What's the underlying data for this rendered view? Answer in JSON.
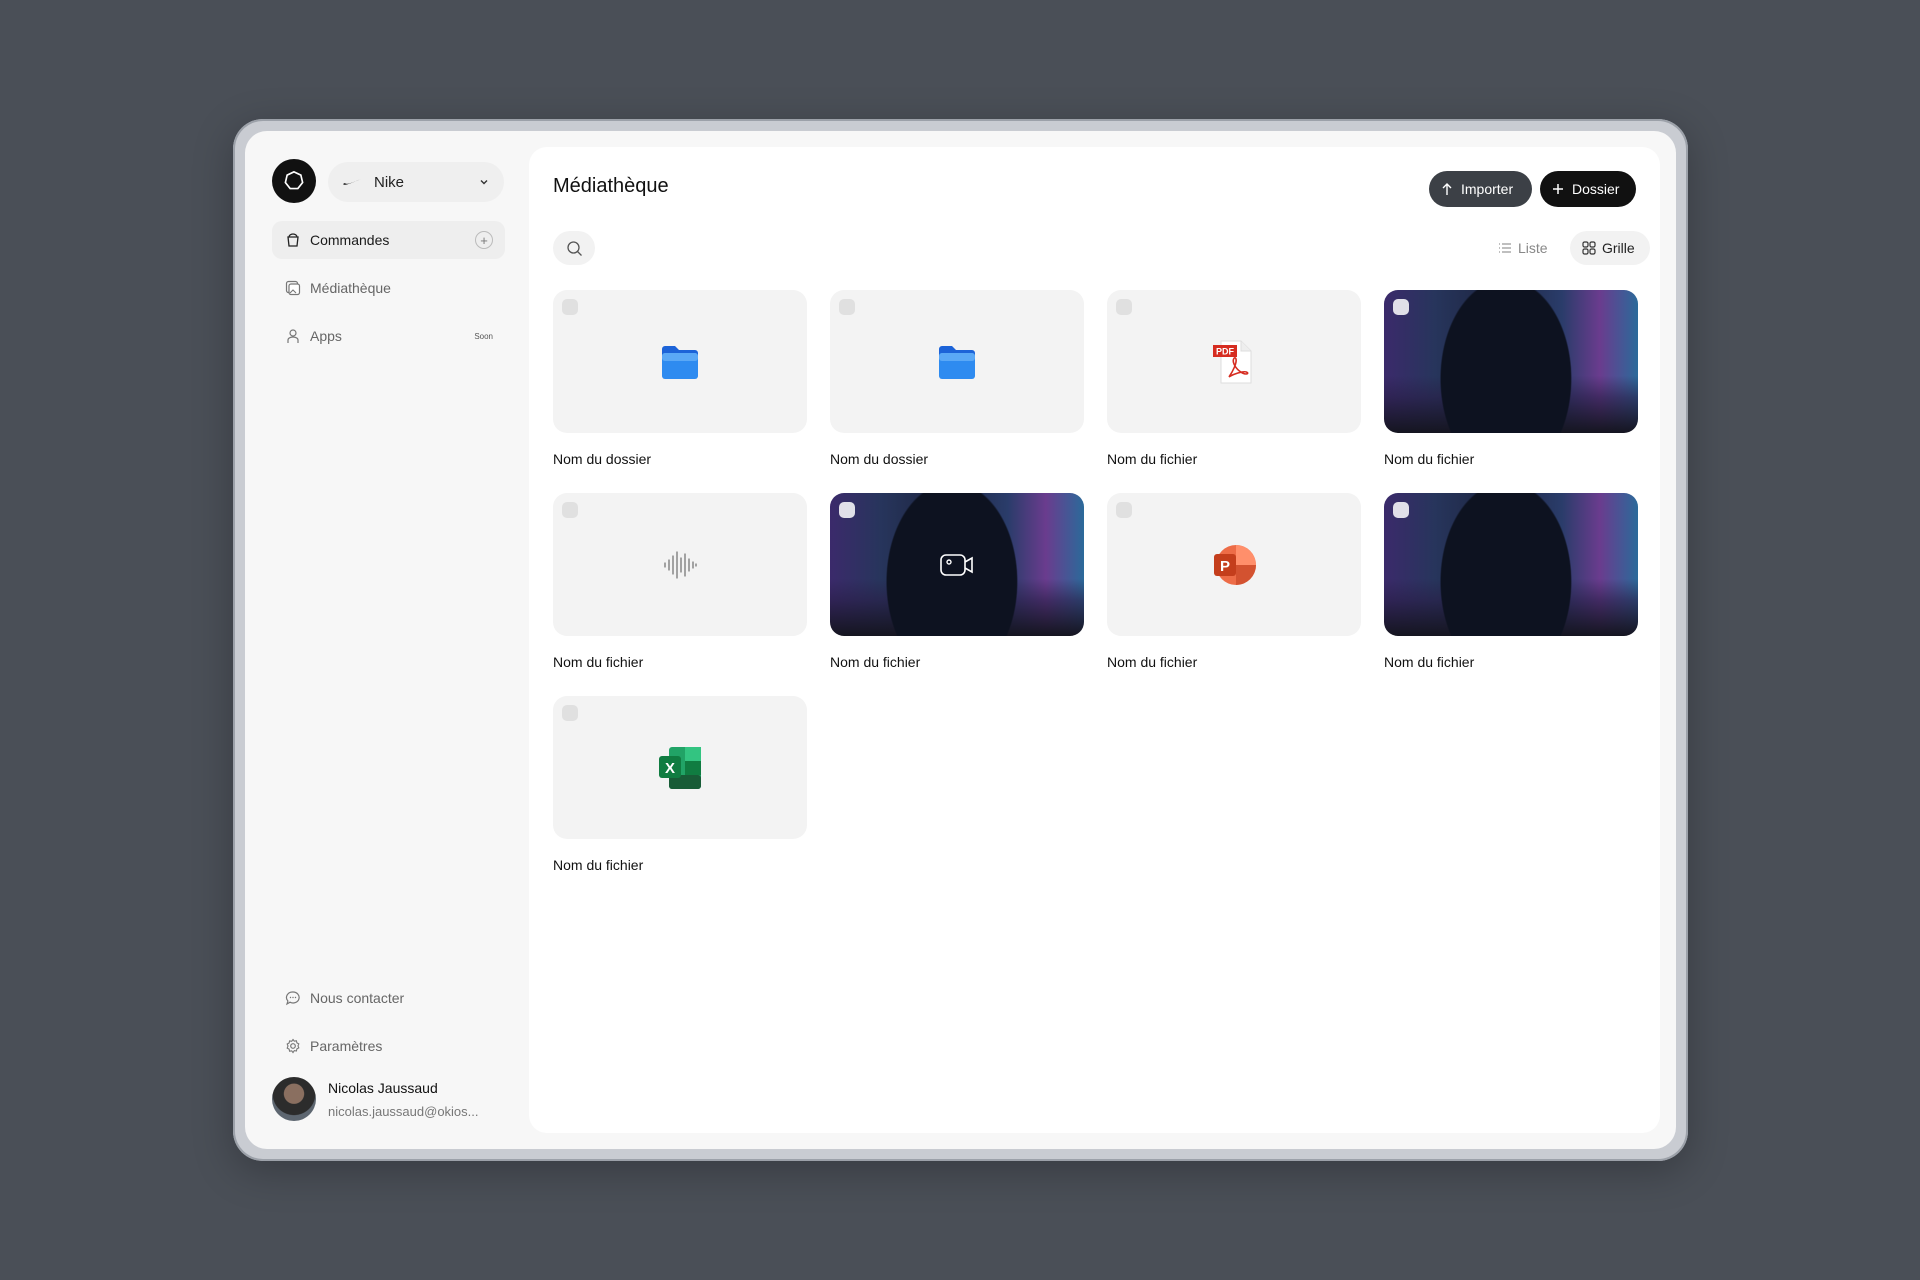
{
  "workspace": {
    "name": "Nike"
  },
  "nav": {
    "items": [
      {
        "label": "Commandes",
        "icon": "bucket-icon"
      },
      {
        "label": "Médiathèque",
        "icon": "media-icon"
      },
      {
        "label": "Apps",
        "icon": "person-icon",
        "badge": "Soon"
      }
    ],
    "contact": "Nous contacter",
    "settings": "Paramètres"
  },
  "user": {
    "name": "Nicolas Jaussaud",
    "email": "nicolas.jaussaud@okios..."
  },
  "main": {
    "title": "Médiathèque",
    "import_label": "Importer",
    "folder_label": "Dossier",
    "view_list": "Liste",
    "view_grid": "Grille"
  },
  "cards": [
    {
      "label": "Nom du dossier",
      "type": "folder"
    },
    {
      "label": "Nom du dossier",
      "type": "folder"
    },
    {
      "label": "Nom du fichier",
      "type": "pdf"
    },
    {
      "label": "Nom du fichier",
      "type": "image"
    },
    {
      "label": "Nom du fichier",
      "type": "audio"
    },
    {
      "label": "Nom du fichier",
      "type": "video"
    },
    {
      "label": "Nom du fichier",
      "type": "powerpoint"
    },
    {
      "label": "Nom du fichier",
      "type": "image"
    },
    {
      "label": "Nom du fichier",
      "type": "excel"
    }
  ],
  "file_badges": {
    "pdf": "PDF",
    "powerpoint": "P",
    "excel": "X"
  }
}
